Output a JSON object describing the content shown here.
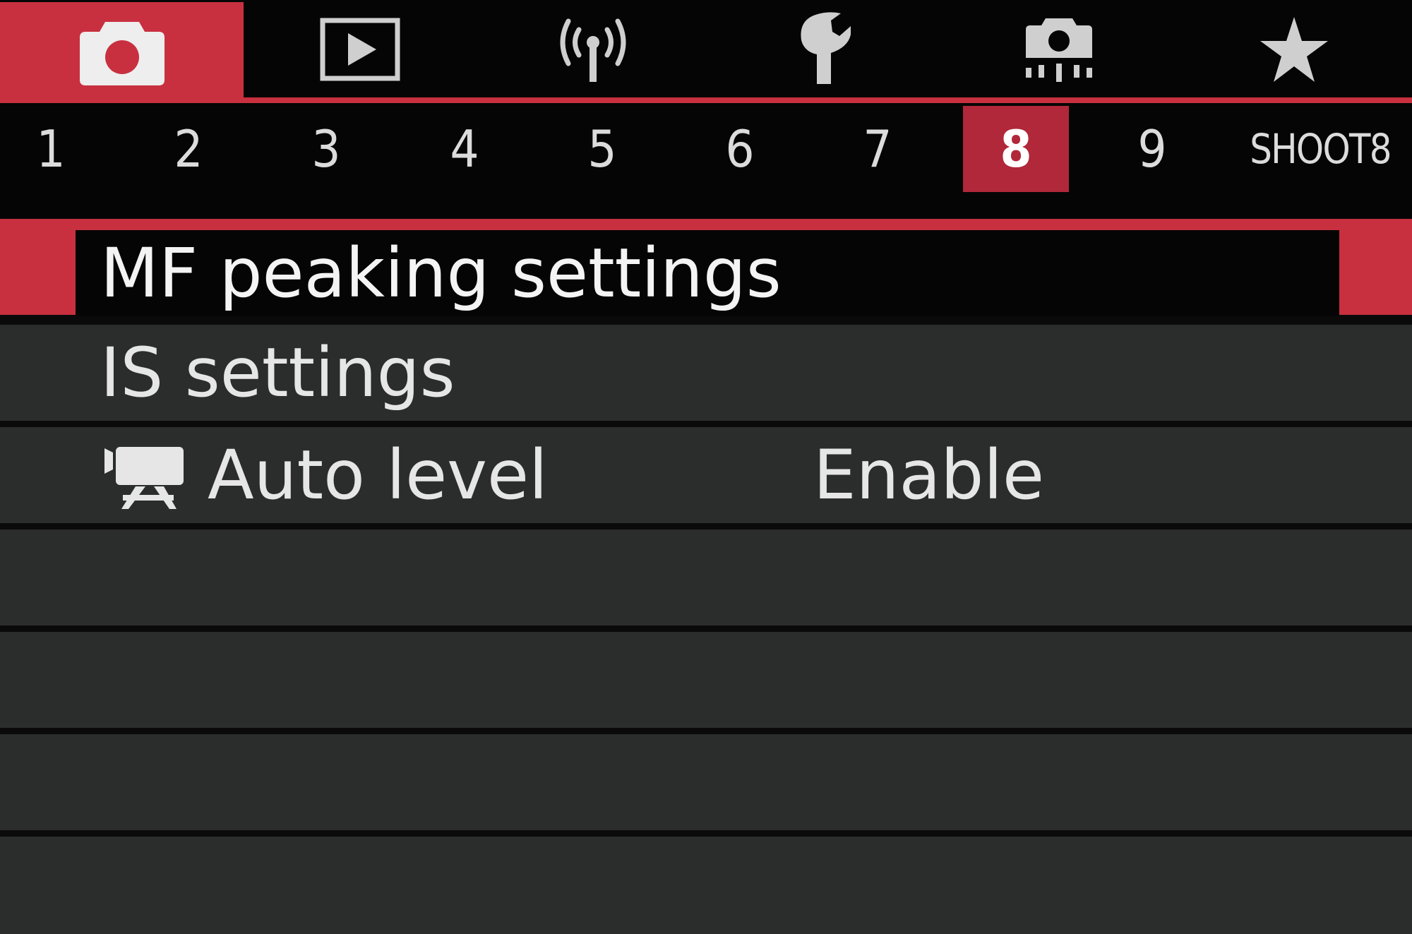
{
  "theme": {
    "accent": "#c8303f",
    "selected_subtab": "#b0283a",
    "row_bg": "#2a2d2b",
    "text": "#e6e6e6"
  },
  "top_tabs": [
    {
      "name": "shooting",
      "icon": "camera-icon",
      "active": true
    },
    {
      "name": "playback",
      "icon": "play-icon",
      "active": false
    },
    {
      "name": "wireless",
      "icon": "wireless-icon",
      "active": false
    },
    {
      "name": "setup",
      "icon": "wrench-icon",
      "active": false
    },
    {
      "name": "custom-functions",
      "icon": "camera-dial-icon",
      "active": false
    },
    {
      "name": "my-menu",
      "icon": "star-icon",
      "active": false
    }
  ],
  "sub_tabs": {
    "items": [
      "1",
      "2",
      "3",
      "4",
      "5",
      "6",
      "7",
      "8",
      "9"
    ],
    "active": "8",
    "page_name": "SHOOT8"
  },
  "menu": {
    "items": [
      {
        "label": "MF peaking settings",
        "value": "",
        "selected": true
      },
      {
        "label": "IS settings",
        "value": "",
        "selected": false
      },
      {
        "label": "Auto level",
        "value": "Enable",
        "icon": "movie-icon",
        "selected": false
      }
    ]
  }
}
